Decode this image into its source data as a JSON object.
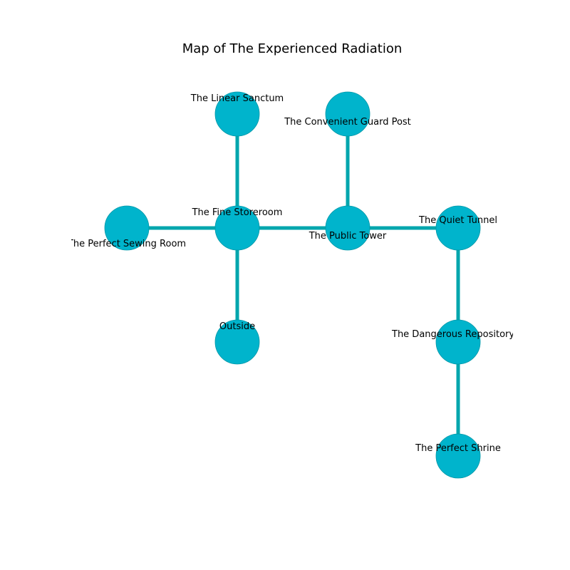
{
  "map": {
    "title": "Map of The Experienced Radiation",
    "colors": {
      "edge": "#00a6ad",
      "node_fill": "#00b4cc",
      "node_stroke": "#0097a7"
    },
    "nodes": [
      {
        "id": "linear-sanctum",
        "label": "The Linear Sanctum"
      },
      {
        "id": "convenient-guard-post",
        "label": "The Convenient Guard Post"
      },
      {
        "id": "perfect-sewing-room",
        "label": "The Perfect Sewing Room"
      },
      {
        "id": "fine-storeroom",
        "label": "The Fine Storeroom"
      },
      {
        "id": "public-tower",
        "label": "The Public Tower"
      },
      {
        "id": "quiet-tunnel",
        "label": "The Quiet Tunnel"
      },
      {
        "id": "outside",
        "label": "Outside"
      },
      {
        "id": "dangerous-repository",
        "label": "The Dangerous Repository"
      },
      {
        "id": "perfect-shrine",
        "label": "The Perfect Shrine"
      }
    ],
    "edges": [
      [
        "linear-sanctum",
        "fine-storeroom"
      ],
      [
        "perfect-sewing-room",
        "fine-storeroom"
      ],
      [
        "fine-storeroom",
        "public-tower"
      ],
      [
        "fine-storeroom",
        "outside"
      ],
      [
        "convenient-guard-post",
        "public-tower"
      ],
      [
        "public-tower",
        "quiet-tunnel"
      ],
      [
        "quiet-tunnel",
        "dangerous-repository"
      ],
      [
        "dangerous-repository",
        "perfect-shrine"
      ]
    ]
  }
}
